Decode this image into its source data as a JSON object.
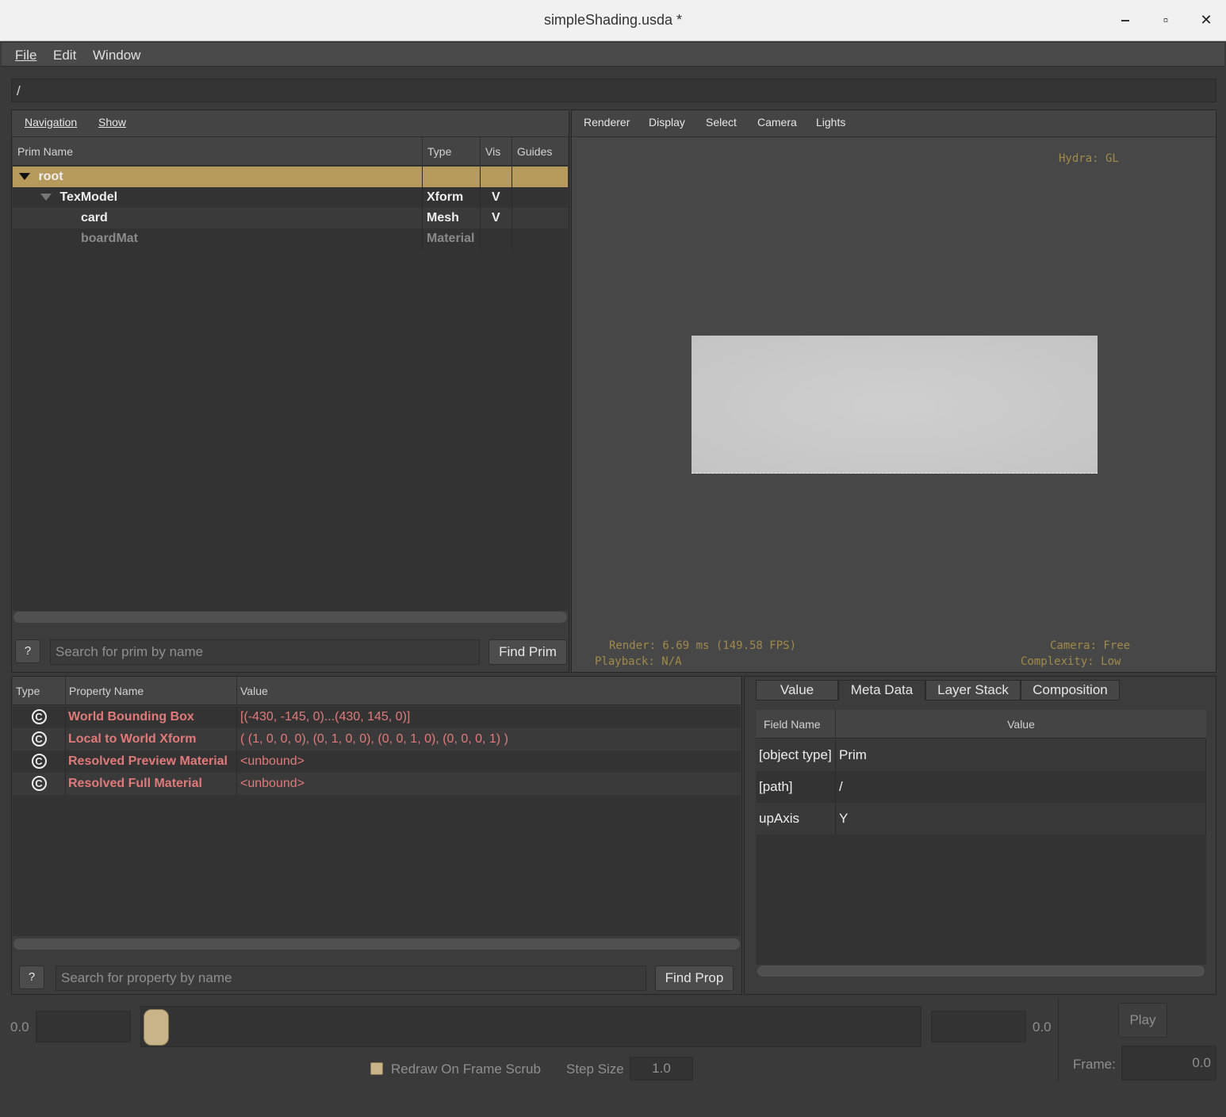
{
  "window": {
    "title": "simpleShading.usda *",
    "minimize": "‒",
    "maximize": "▫",
    "close": "✕"
  },
  "menu": [
    "File",
    "Edit",
    "Window"
  ],
  "path": "/",
  "prim_browser": {
    "menu": [
      "Navigation",
      "Show"
    ],
    "columns": [
      "Prim Name",
      "Type",
      "Vis",
      "Guides"
    ],
    "rows": [
      {
        "name": "root",
        "type": "",
        "vis": "",
        "guides": ""
      },
      {
        "name": "TexModel",
        "type": "Xform",
        "vis": "V",
        "guides": ""
      },
      {
        "name": "card",
        "type": "Mesh",
        "vis": "V",
        "guides": ""
      },
      {
        "name": "boardMat",
        "type": "Material",
        "vis": "",
        "guides": ""
      }
    ],
    "help_button": "?",
    "search_placeholder": "Search for prim by name",
    "find_button": "Find Prim"
  },
  "viewport": {
    "menu": [
      "Renderer",
      "Display",
      "Select",
      "Camera",
      "Lights"
    ],
    "hud_renderer": "Hydra: GL",
    "hud_render": "Render: 6.69 ms (149.58 FPS)",
    "hud_playback": "Playback: N/A",
    "hud_camera": "Camera: Free",
    "hud_complexity": "Complexity: Low"
  },
  "properties": {
    "columns": [
      "Type",
      "Property Name",
      "Value"
    ],
    "rows": [
      {
        "type_icon": "C",
        "name": "World Bounding Box",
        "value": "[(-430, -145, 0)...(430, 145, 0)]"
      },
      {
        "type_icon": "C",
        "name": "Local to World Xform",
        "value": "( (1, 0, 0, 0), (0, 1, 0, 0), (0, 0, 1, 0), (0, 0, 0, 1) )"
      },
      {
        "type_icon": "C",
        "name": "Resolved Preview Material",
        "value": "<unbound>"
      },
      {
        "type_icon": "C",
        "name": "Resolved Full Material",
        "value": "<unbound>"
      }
    ],
    "help_button": "?",
    "search_placeholder": "Search for property by name",
    "find_button": "Find Prop"
  },
  "metadata": {
    "tabs": [
      "Value",
      "Meta Data",
      "Layer Stack",
      "Composition"
    ],
    "active_tab": "Meta Data",
    "columns": [
      "Field Name",
      "Value"
    ],
    "rows": [
      {
        "field": "[object type]",
        "value": "Prim"
      },
      {
        "field": "[path]",
        "value": "/"
      },
      {
        "field": "upAxis",
        "value": "Y"
      }
    ]
  },
  "timeline": {
    "start_label": "0.0",
    "end_label": "0.0",
    "play_button": "Play",
    "redraw_label": "Redraw On Frame Scrub",
    "step_size_label": "Step Size",
    "step_size_value": "1.0",
    "frame_label": "Frame:",
    "frame_value": "0.0"
  },
  "colors": {
    "selection": "#b59a5c",
    "property_text": "#e07a7a",
    "hud_text": "#a08a4a"
  }
}
